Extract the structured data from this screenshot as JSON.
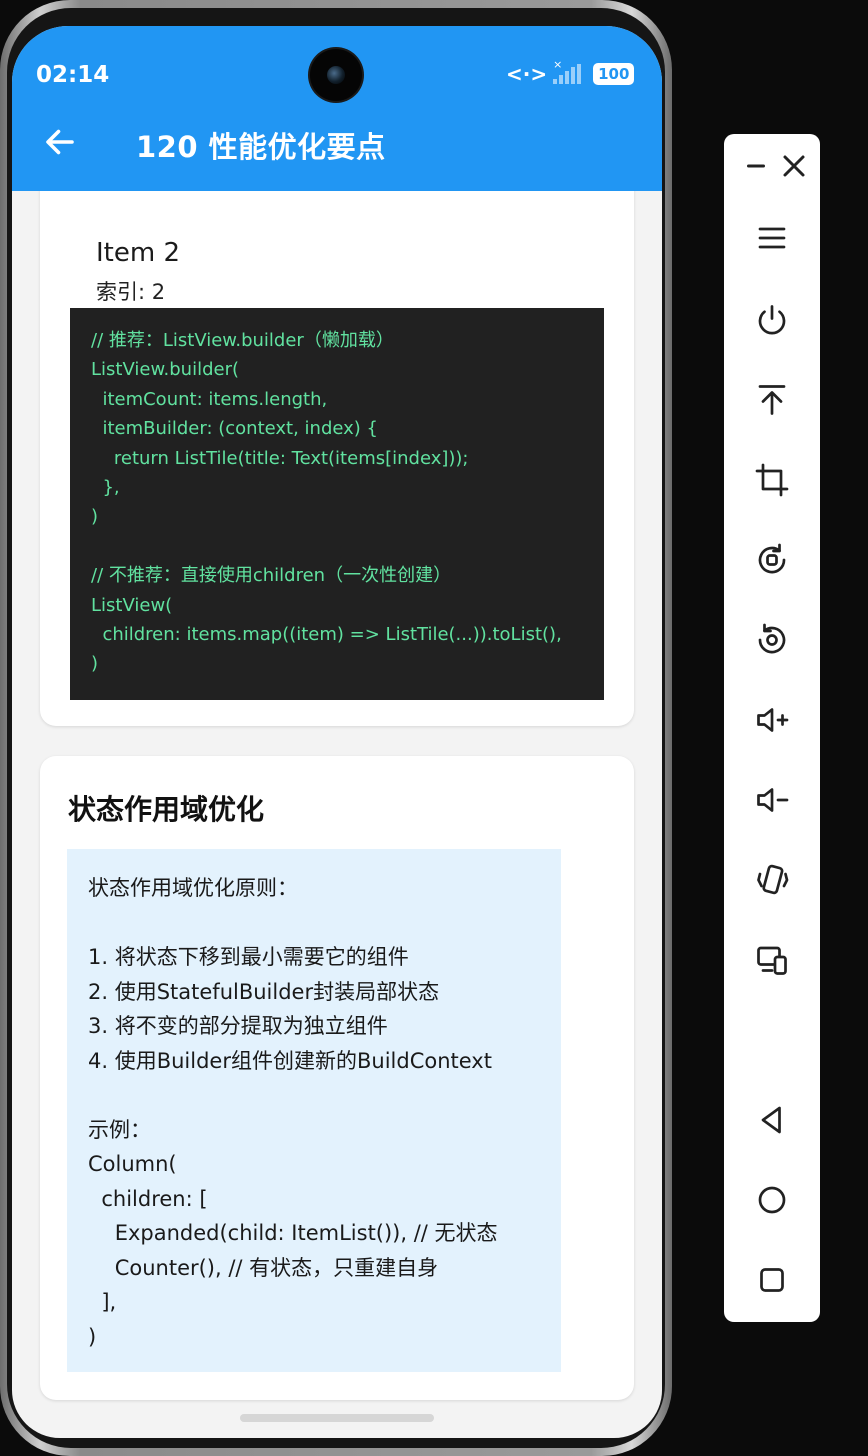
{
  "status_bar": {
    "time": "02:14",
    "network_icon": "data-transfer-icon",
    "signal_icon": "signal-no-service-icon",
    "battery": "100"
  },
  "app_bar": {
    "back_icon": "arrow-left-icon",
    "title": "120 性能优化要点"
  },
  "list_card": {
    "item_title": "Item 2",
    "item_subtitle": "索引: 2",
    "code": "// 推荐：ListView.builder（懒加载）\nListView.builder(\n  itemCount: items.length,\n  itemBuilder: (context, index) {\n    return ListTile(title: Text(items[index]));\n  },\n)\n\n// 不推荐：直接使用children（一次性创建）\nListView(\n  children: items.map((item) => ListTile(...)).toList(),\n)"
  },
  "state_card": {
    "title": "状态作用域优化",
    "code": "状态作用域优化原则：\n\n1. 将状态下移到最小需要它的组件\n2. 使用StatefulBuilder封装局部状态\n3. 将不变的部分提取为独立组件\n4. 使用Builder组件创建新的BuildContext\n\n示例：\nColumn(\n  children: [\n    Expanded(child: ItemList()), // 无状态\n    Counter(), // 有状态，只重建自身\n  ],\n)"
  },
  "emulator_toolbar": {
    "buttons": [
      "minimize-icon",
      "close-icon",
      "menu-icon",
      "power-icon",
      "pin-top-icon",
      "crop-icon",
      "rotate-left-icon",
      "rotate-right-icon",
      "volume-up-icon",
      "volume-down-icon",
      "shake-icon",
      "multi-device-icon",
      "back-nav-icon",
      "home-nav-icon",
      "recents-nav-icon"
    ]
  },
  "colors": {
    "app_bar": "#2196f3",
    "code_dark_bg": "#212121",
    "code_dark_text": "#61e2a0",
    "code_light_bg": "#e3f2fd"
  }
}
